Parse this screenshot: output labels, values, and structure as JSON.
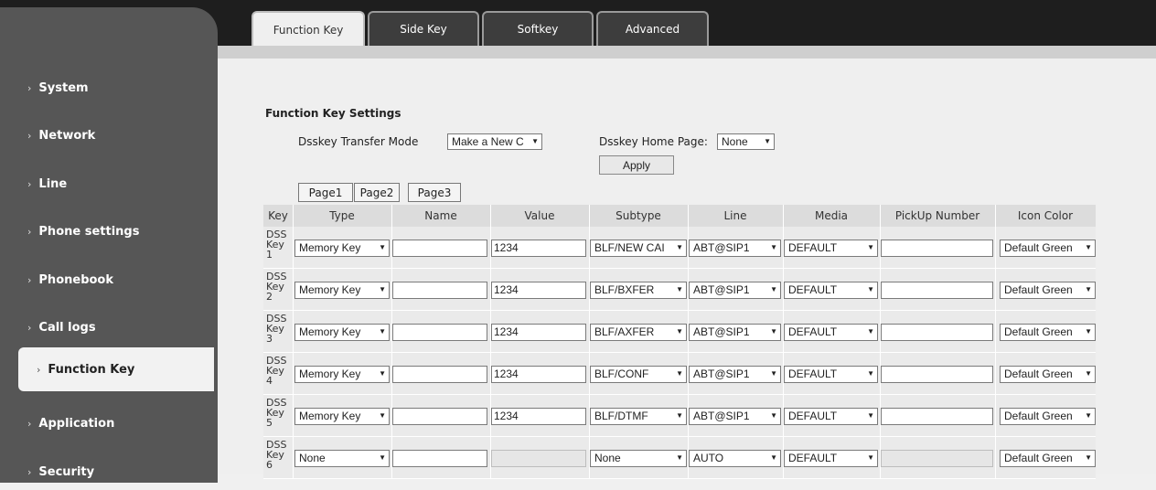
{
  "tabs": [
    "Function Key",
    "Side Key",
    "Softkey",
    "Advanced"
  ],
  "sidebar": {
    "items": [
      "System",
      "Network",
      "Line",
      "Phone settings",
      "Phonebook",
      "Call logs",
      "Function Key",
      "Application",
      "Security"
    ],
    "chevron": "›"
  },
  "settings": {
    "title": "Function Key Settings",
    "transfer_mode_label": "Dsskey Transfer Mode",
    "transfer_mode_value": "Make a New C",
    "home_page_label": "Dsskey Home Page:",
    "home_page_value": "None",
    "apply_label": "Apply"
  },
  "pages": [
    "Page1",
    "Page2",
    "Page3"
  ],
  "table": {
    "headers": [
      "Key",
      "Type",
      "Name",
      "Value",
      "Subtype",
      "Line",
      "Media",
      "PickUp Number",
      "Icon Color"
    ],
    "rows": [
      {
        "key": [
          "DSS",
          "Key",
          "1"
        ],
        "type": "Memory Key",
        "name": "",
        "value": "1234",
        "subtype": "BLF/NEW CAI",
        "line": "ABT@SIP1",
        "media": "DEFAULT",
        "pickup": "",
        "icon_color": "Default Green"
      },
      {
        "key": [
          "DSS",
          "Key",
          "2"
        ],
        "type": "Memory Key",
        "name": "",
        "value": "1234",
        "subtype": "BLF/BXFER",
        "line": "ABT@SIP1",
        "media": "DEFAULT",
        "pickup": "",
        "icon_color": "Default Green"
      },
      {
        "key": [
          "DSS",
          "Key",
          "3"
        ],
        "type": "Memory Key",
        "name": "",
        "value": "1234",
        "subtype": "BLF/AXFER",
        "line": "ABT@SIP1",
        "media": "DEFAULT",
        "pickup": "",
        "icon_color": "Default Green"
      },
      {
        "key": [
          "DSS",
          "Key",
          "4"
        ],
        "type": "Memory Key",
        "name": "",
        "value": "1234",
        "subtype": "BLF/CONF",
        "line": "ABT@SIP1",
        "media": "DEFAULT",
        "pickup": "",
        "icon_color": "Default Green"
      },
      {
        "key": [
          "DSS",
          "Key",
          "5"
        ],
        "type": "Memory Key",
        "name": "",
        "value": "1234",
        "subtype": "BLF/DTMF",
        "line": "ABT@SIP1",
        "media": "DEFAULT",
        "pickup": "",
        "icon_color": "Default Green"
      },
      {
        "key": [
          "DSS",
          "Key",
          "6"
        ],
        "type": "None",
        "name": "",
        "value": "",
        "subtype": "None",
        "line": "AUTO",
        "media": "DEFAULT",
        "pickup": "",
        "icon_color": "Default Green"
      }
    ]
  },
  "dropdown_arrow": "▼"
}
